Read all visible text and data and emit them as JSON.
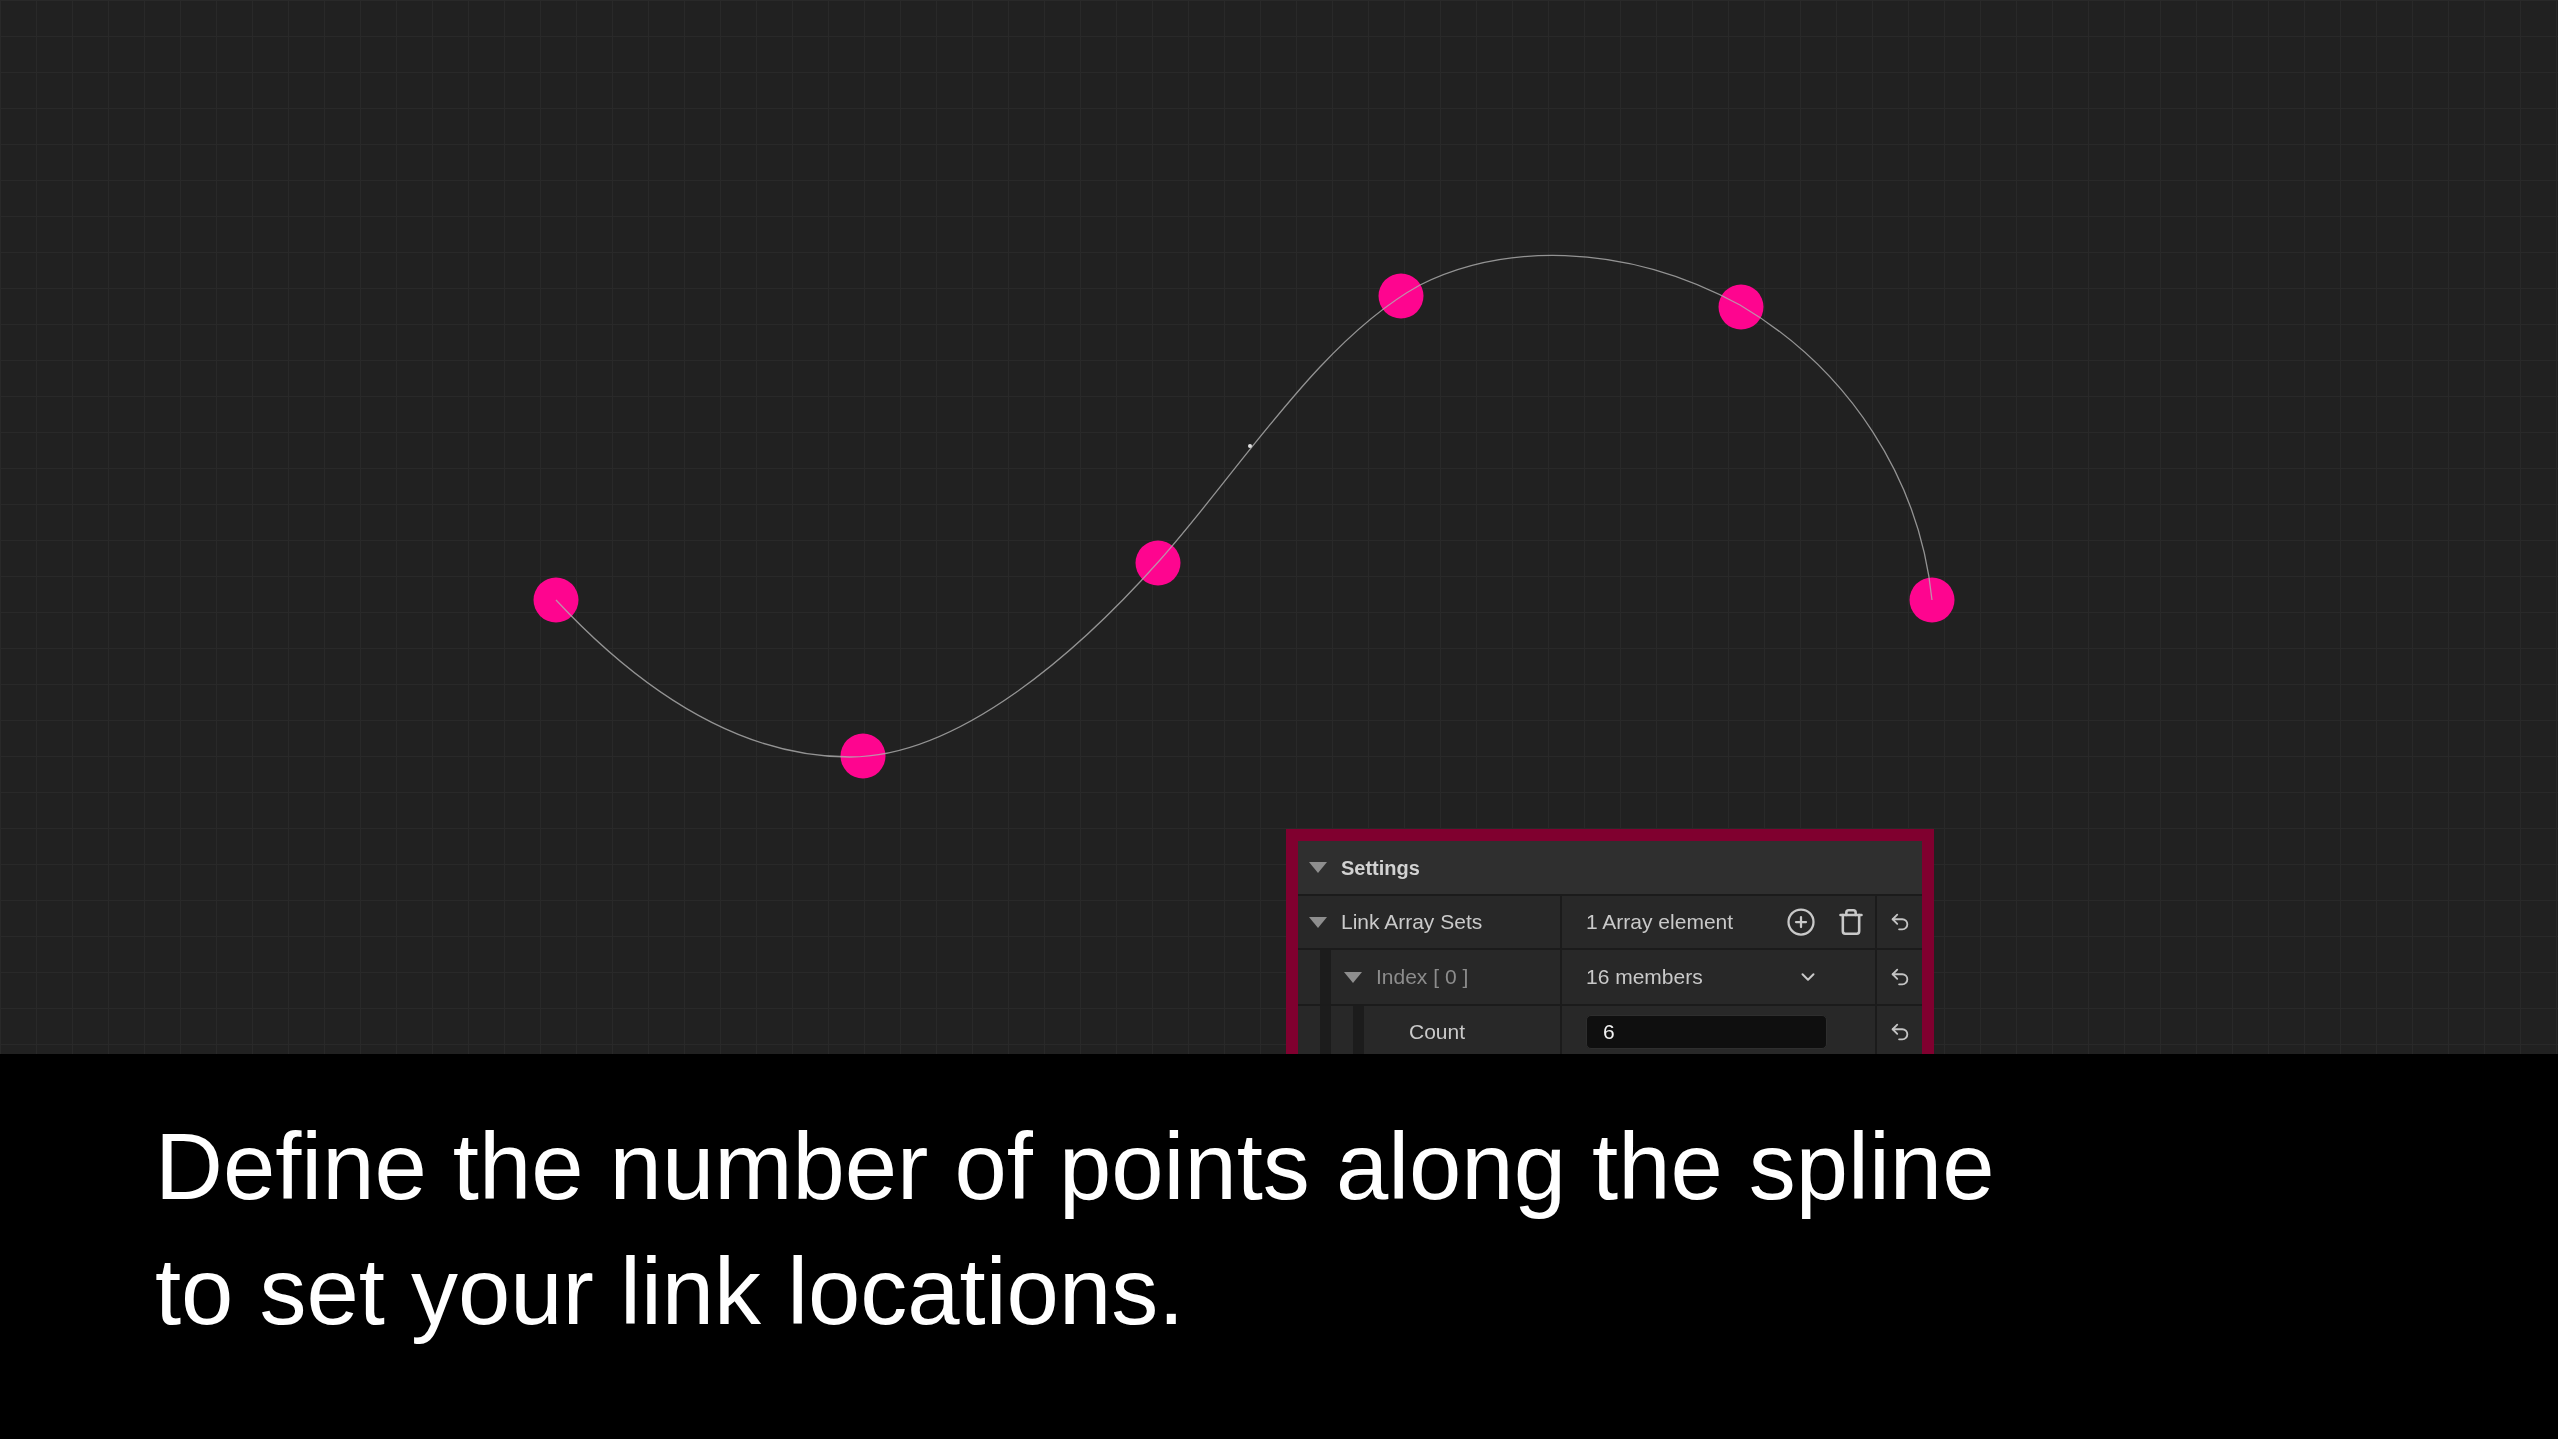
{
  "settings": {
    "label": "Settings",
    "expanded": true,
    "children": [
      {
        "kind": "array",
        "label": "Link Array Sets",
        "expanded": true,
        "value": "1 Array element",
        "children": [
          {
            "kind": "struct",
            "label": "Index [ 0 ]",
            "expanded": true,
            "value": "16 members",
            "children": [
              {
                "kind": "number",
                "label": "Count",
                "value": "6"
              }
            ]
          }
        ]
      }
    ]
  },
  "caption": {
    "lines": [
      "Define the number of points along the spline",
      "to set your link locations."
    ]
  }
}
